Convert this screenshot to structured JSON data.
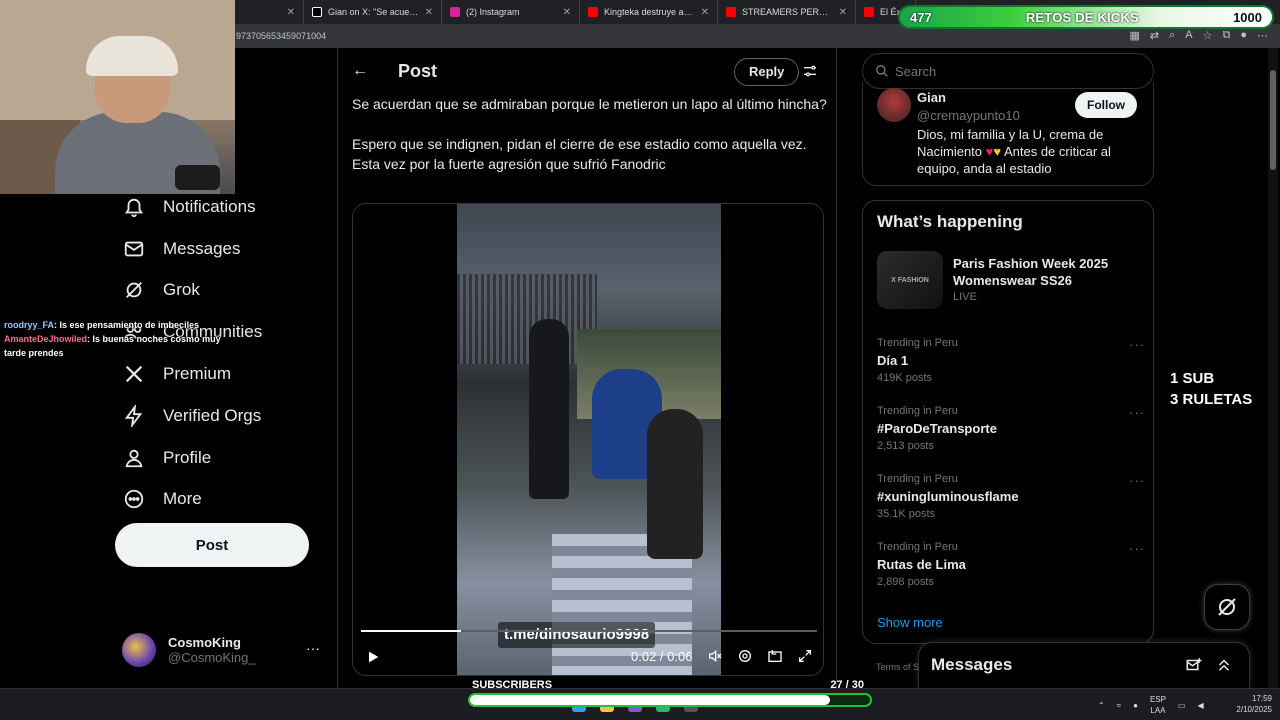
{
  "browser": {
    "tabs": [
      {
        "title": "",
        "favicon_color": "#5f6368"
      },
      {
        "title": "Gian on X: \"Se acuerdan qu",
        "favicon_color": "#ffffff"
      },
      {
        "title": "(2) Instagram",
        "favicon_color": "#d6249f"
      },
      {
        "title": "Kingteka destruye a Venecia",
        "favicon_color": "#ff0000"
      },
      {
        "title": "STREAMERS PERUANOS qu",
        "favicon_color": "#ff0000"
      },
      {
        "title": "El Éxi",
        "favicon_color": "#ff0000"
      }
    ],
    "url": "973705653459071004"
  },
  "kicks": {
    "left": "477",
    "label": "RETOS DE KICKS",
    "right": "1000"
  },
  "nav": {
    "items": [
      {
        "label": "Notifications",
        "icon": "bell-icon"
      },
      {
        "label": "Messages",
        "icon": "envelope-icon"
      },
      {
        "label": "Grok",
        "icon": "grok-icon"
      },
      {
        "label": "Communities",
        "icon": "communities-icon"
      },
      {
        "label": "Premium",
        "icon": "x-logo-icon"
      },
      {
        "label": "Verified Orgs",
        "icon": "lightning-icon"
      },
      {
        "label": "Profile",
        "icon": "person-icon"
      },
      {
        "label": "More",
        "icon": "more-circle-icon"
      }
    ],
    "post_label": "Post",
    "account": {
      "name": "CosmoKing",
      "handle": "@CosmoKing_",
      "more": "···"
    }
  },
  "chat": {
    "line1_user": "roodryy_FA",
    "line1_text": ": Is ese pensamiento de imbeciles",
    "line2_user": "AmanteDeJhowiled",
    "line2_text": ": Is buenas noches cosmo muy tarde prendes"
  },
  "post": {
    "header_title": "Post",
    "reply_label": "Reply",
    "paragraph1": "Se acuerdan que se admiraban porque le metieron un lapo al último hincha?",
    "paragraph2": "Espero que se indignen, pidan el cierre de ese estadio como aquella vez. Esta vez por la fuerte agresión que sufrió Fanodric",
    "video": {
      "watermark": "t.me/dinosaurio9998",
      "time": "0:02 / 0:06",
      "progress": 0.22
    }
  },
  "right": {
    "search_placeholder": "Search",
    "profile": {
      "name": "Gian",
      "handle": "@cremaypunto10",
      "follow_label": "Follow",
      "bio_part1": "Dios, mi familia y la U, crema de Nacimiento ",
      "heart_red": "♥",
      "heart_yellow": "♥",
      "bio_part2": " Antes de criticar al equipo, anda al estadio"
    },
    "happening": {
      "title": "What’s happening",
      "event": {
        "title": "Paris Fashion Week 2025 Womenswear SS26",
        "status": "LIVE",
        "thumb_text": "X FASHION"
      },
      "trends": [
        {
          "context": "Trending in Peru",
          "name": "Día 1",
          "count": "419K posts"
        },
        {
          "context": "Trending in Peru",
          "name": "#ParoDeTransporte",
          "count": "2,513 posts"
        },
        {
          "context": "Trending in Peru",
          "name": "#xuningluminousflame",
          "count": "35.1K posts"
        },
        {
          "context": "Trending in Peru",
          "name": "Rutas de Lima",
          "count": "2,898 posts"
        }
      ],
      "show_more": "Show more"
    },
    "terms": "Terms of S",
    "messages_title": "Messages"
  },
  "overlay": {
    "line1": "1 SUB",
    "line2": "3 RULETAS"
  },
  "subs_bar": {
    "label": "SUBSCRIBERS",
    "count": "27 / 30",
    "progress": 0.9
  },
  "taskbar": {
    "lang1": "ESP",
    "lang2": "LAA",
    "time": "17:59",
    "date": "2/10/2025"
  }
}
